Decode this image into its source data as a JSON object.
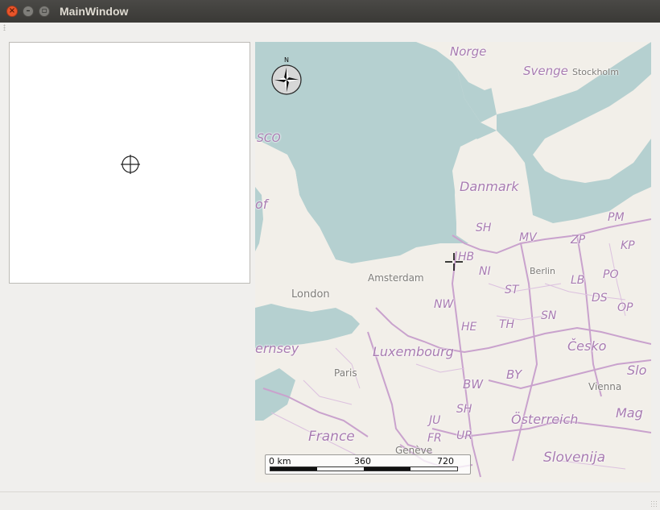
{
  "window": {
    "title": "MainWindow"
  },
  "left_panel": {
    "crosshair_icon": "crosshair-icon"
  },
  "map": {
    "compass_label": "N",
    "labels": {
      "norge": "Norge",
      "svenge": "Svenge",
      "stockholm": "Stockholm",
      "sco": "SCO",
      "danmark": "Danmark",
      "sh_north": "SH",
      "mv": "MV",
      "zp": "ZP",
      "pm": "PM",
      "kp": "KP",
      "hb": "HB",
      "berlin": "Berlin",
      "lb": "LB",
      "po": "PO",
      "ni": "NI",
      "amsterdam": "Amsterdam",
      "london": "London",
      "st": "ST",
      "ds": "DS",
      "op": "OP",
      "nw": "NW",
      "sn": "SN",
      "he": "HE",
      "th": "TH",
      "ernsey": "ernsey",
      "luxembourg": "Luxembourg",
      "cesko": "Česko",
      "slo": "Slo",
      "paris": "Paris",
      "by": "BY",
      "bw": "BW",
      "vienna": "Vienna",
      "sh_south": "SH",
      "osterreich": "Österreich",
      "mag": "Mag",
      "ju": "JU",
      "fr": "FR",
      "ur": "UR",
      "france": "France",
      "geneve": "Genève",
      "slovenija": "Slovenija",
      "of": "of"
    },
    "scale": {
      "label_0": "0 km",
      "label_mid": "360",
      "label_max": "720"
    }
  },
  "colors": {
    "water": "#b5d0d0",
    "land": "#f2efe9",
    "border": "#c9a2cd",
    "close_button": "#e9552a"
  }
}
